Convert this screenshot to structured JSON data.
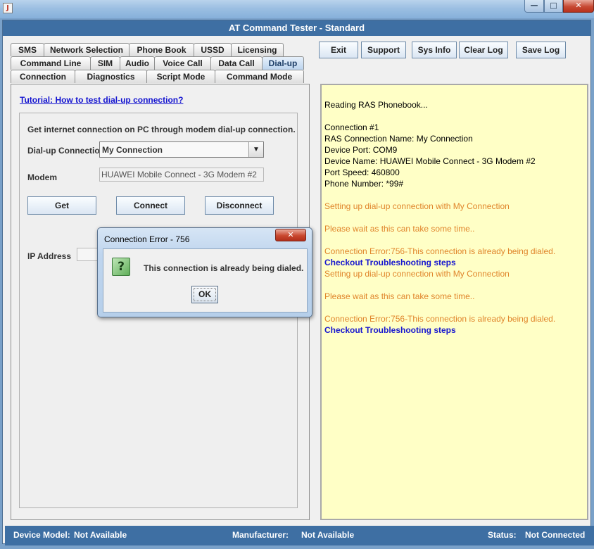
{
  "window": {
    "app_title": "AT Command Tester - Standard",
    "minimize_icon": "minimize-icon",
    "maximize_icon": "maximize-icon",
    "close_icon": "close-icon",
    "minimize_glyph": "—",
    "maximize_glyph": "□",
    "close_glyph": "✕"
  },
  "tabs": {
    "row1": [
      "SMS",
      "Network Selection",
      "Phone Book",
      "USSD",
      "Licensing"
    ],
    "row2": [
      "Command Line",
      "SIM",
      "Audio",
      "Voice Call",
      "Data Call",
      "Dial-up"
    ],
    "row3": [
      "Connection",
      "Diagnostics",
      "Script Mode",
      "Command Mode"
    ],
    "selected": "Dial-up"
  },
  "toolbar": {
    "exit": "Exit",
    "support": "Support",
    "sysinfo": "Sys Info",
    "clearlog": "Clear Log",
    "savelog": "Save Log"
  },
  "dialup": {
    "tutorial_link": "Tutorial: How to test dial-up connection?",
    "description": "Get internet connection on PC through modem dial-up connection.",
    "connection_label": "Dial-up Connection",
    "connection_value": "My Connection",
    "modem_label": "Modem",
    "modem_value": "HUAWEI Mobile Connect - 3G Modem #2",
    "get_button": "Get",
    "connect_button": "Connect",
    "disconnect_button": "Disconnect",
    "ip_label": "IP Address",
    "ip_value": ""
  },
  "log": {
    "lines": [
      {
        "text": "Reading RAS Phonebook...",
        "kind": "normal"
      },
      {
        "text": "",
        "kind": "normal"
      },
      {
        "text": "Connection #1",
        "kind": "normal"
      },
      {
        "text": "RAS Connection Name: My Connection",
        "kind": "normal"
      },
      {
        "text": "Device Port: COM9",
        "kind": "normal"
      },
      {
        "text": "Device Name: HUAWEI Mobile Connect - 3G Modem #2",
        "kind": "normal"
      },
      {
        "text": "Port Speed: 460800",
        "kind": "normal"
      },
      {
        "text": "Phone Number: *99#",
        "kind": "normal"
      },
      {
        "text": "",
        "kind": "normal"
      },
      {
        "text": "Setting up dial-up connection with My Connection",
        "kind": "warn"
      },
      {
        "text": "",
        "kind": "normal"
      },
      {
        "text": "Please wait as this can take some time..",
        "kind": "warn"
      },
      {
        "text": "",
        "kind": "normal"
      },
      {
        "text": "Connection Error:756-This connection is already being dialed.",
        "kind": "warn"
      },
      {
        "text": "Checkout Troubleshooting steps",
        "kind": "link"
      },
      {
        "text": "Setting up dial-up connection with My Connection",
        "kind": "warn"
      },
      {
        "text": "",
        "kind": "normal"
      },
      {
        "text": "Please wait as this can take some time..",
        "kind": "warn"
      },
      {
        "text": "",
        "kind": "normal"
      },
      {
        "text": "Connection Error:756-This connection is already being dialed.",
        "kind": "warn"
      },
      {
        "text": "Checkout Troubleshooting steps",
        "kind": "link"
      }
    ],
    "colors": {
      "normal": "#000000",
      "warn": "#e0852b",
      "link": "#1818cf",
      "background": "#ffffc6"
    }
  },
  "status": {
    "device_model_label": "Device Model:",
    "device_model_value": "Not Available",
    "manufacturer_label": "Manufacturer:",
    "manufacturer_value": "Not Available",
    "status_label": "Status:",
    "status_value": "Not Connected"
  },
  "dialog": {
    "title": "Connection Error - 756",
    "message": "This connection is already being dialed.",
    "icon": "question-icon",
    "icon_glyph": "?",
    "ok_button": "OK",
    "close_glyph": "✕"
  }
}
